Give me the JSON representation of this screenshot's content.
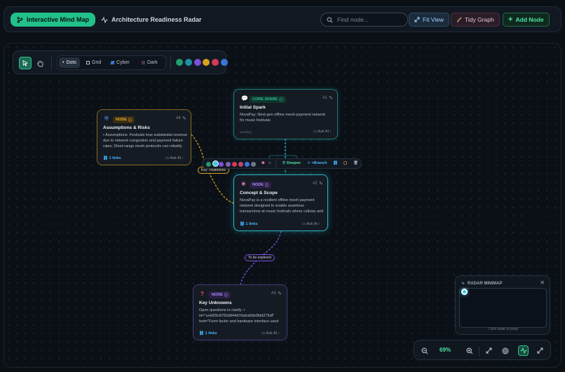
{
  "topbar": {
    "tab_mindmap": "Interactive Mind Map",
    "tab_radar": "Architecture Readiness Radar",
    "search_placeholder": "Find node...",
    "fit_view": "Fit View",
    "tidy_graph": "Tidy Graph",
    "add_node": "Add Node"
  },
  "toolbar": {
    "bg_options": [
      "Dots",
      "Grid",
      "Cyber",
      "Dark"
    ],
    "selected_bg": "Dots",
    "swatches": [
      "#1f9d6b",
      "#1f8fa3",
      "#7b4fd6",
      "#d6a21f",
      "#d23a55",
      "#3a76d6"
    ]
  },
  "nodes": {
    "core": {
      "badge": "CORE SPARK",
      "index": "#1",
      "title": "Initial Spark",
      "body": "NovaPay: Next-gen offline mesh payment network for music festivals",
      "meta": "seedling",
      "ask": "Ask AI"
    },
    "assumptions": {
      "badge": "NODE",
      "index": "#4",
      "title": "Assumptions & Risks",
      "body": "• Assumptions: Festivals lose substantial revenue due to network congestion and payment failure rates; Short-range mesh protocols can reliably bat...",
      "links": "1 links",
      "ask": "Ask AI"
    },
    "concept": {
      "badge": "NODE",
      "index": "#2",
      "title": "Concept & Scope",
      "body": "NovaPay is a resilient offline mesh payment network designed to enable seamless transactions at music festivals where cellular and internet connectivity fa...",
      "links": "1 links",
      "ask": "Ask AI"
    },
    "unknowns": {
      "badge": "NODE",
      "index": "#3",
      "title": "Key Unknowns",
      "body": "Open questions to clarify: • id=\"unk6f3c8781b844d7da6a6bb3fdd275df\" text=\"Form factor and hardware interface used by...",
      "links": "1 links",
      "ask": "Ask AI"
    }
  },
  "edges": {
    "assumptions_label": "Key Treatments",
    "unknowns_label": "To be explored"
  },
  "nodebar": {
    "swatches": [
      "#1f9d6b",
      "#35c6e8",
      "#7b4fd6",
      "#8a5fb8",
      "#d23a55",
      "#c2456a",
      "#3a76d6",
      "#6b7a89"
    ],
    "deepen": "Deepen",
    "branch": "+Branch"
  },
  "minimap": {
    "title": "RADAR MINIMAP",
    "hint": "Click radar to jump"
  },
  "zoom": {
    "value": "69%"
  }
}
